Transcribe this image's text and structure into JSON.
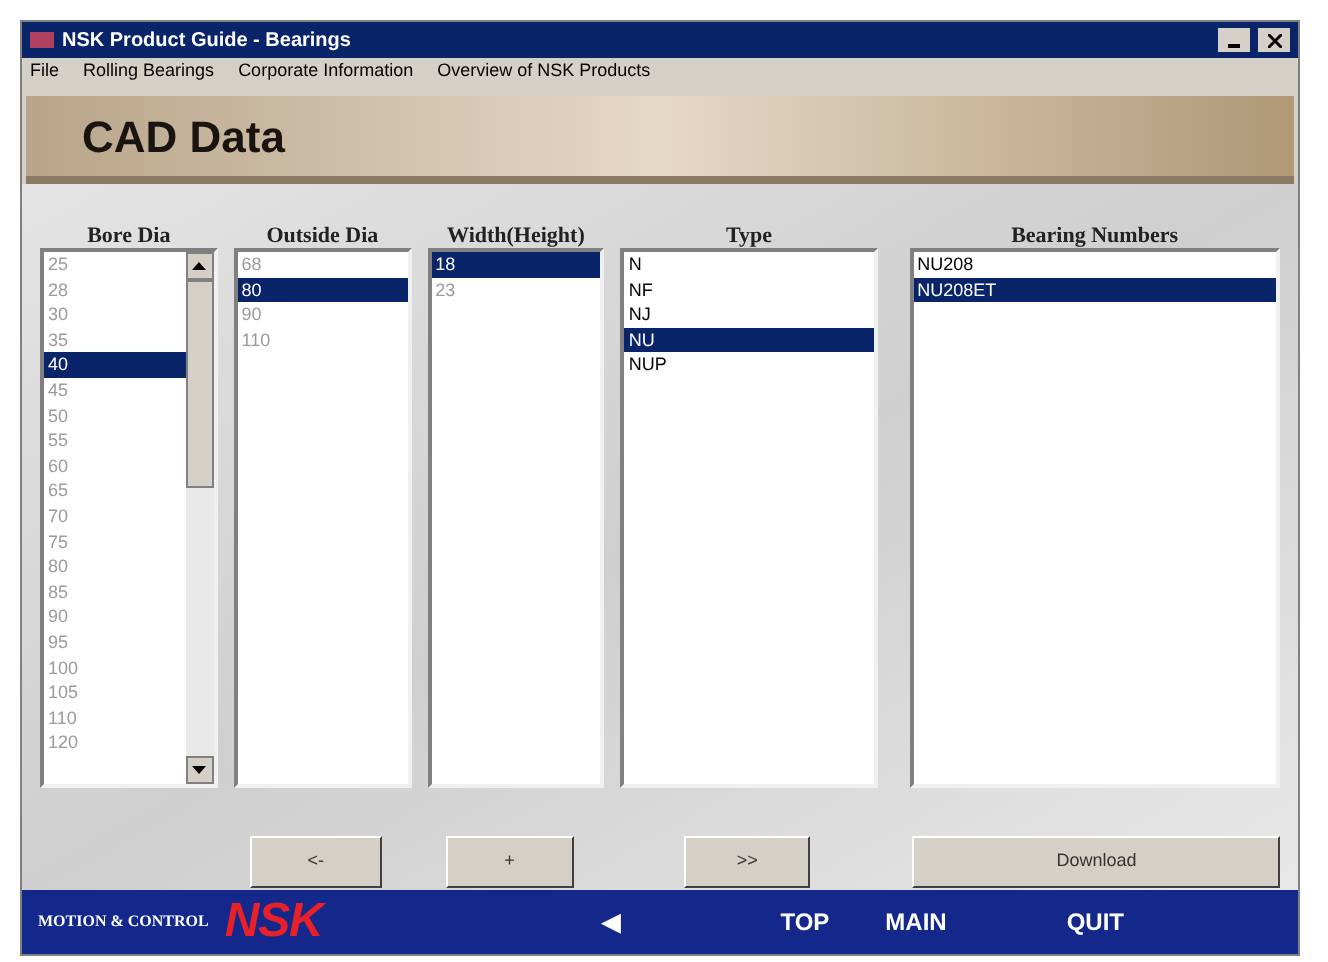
{
  "window": {
    "title": "NSK Product Guide - Bearings"
  },
  "menu": [
    "File",
    "Rolling Bearings",
    "Corporate Information",
    "Overview of NSK Products"
  ],
  "banner": {
    "title": "CAD Data"
  },
  "columns": [
    {
      "header": "Bore Dia",
      "dimmed": true,
      "scrollbar": true,
      "items": [
        {
          "text": "25",
          "selected": false
        },
        {
          "text": "28",
          "selected": false
        },
        {
          "text": "30",
          "selected": false
        },
        {
          "text": "35",
          "selected": false
        },
        {
          "text": "40",
          "selected": true
        },
        {
          "text": "45",
          "selected": false
        },
        {
          "text": "50",
          "selected": false
        },
        {
          "text": "55",
          "selected": false
        },
        {
          "text": "60",
          "selected": false
        },
        {
          "text": "65",
          "selected": false
        },
        {
          "text": "70",
          "selected": false
        },
        {
          "text": "75",
          "selected": false
        },
        {
          "text": "80",
          "selected": false
        },
        {
          "text": "85",
          "selected": false
        },
        {
          "text": "90",
          "selected": false
        },
        {
          "text": "95",
          "selected": false
        },
        {
          "text": "100",
          "selected": false
        },
        {
          "text": "105",
          "selected": false
        },
        {
          "text": "110",
          "selected": false
        },
        {
          "text": "120",
          "selected": false
        }
      ]
    },
    {
      "header": "Outside Dia",
      "dimmed": true,
      "scrollbar": false,
      "items": [
        {
          "text": "68",
          "selected": false
        },
        {
          "text": "80",
          "selected": true
        },
        {
          "text": "90",
          "selected": false
        },
        {
          "text": "110",
          "selected": false
        }
      ]
    },
    {
      "header": "Width(Height)",
      "dimmed": true,
      "scrollbar": false,
      "items": [
        {
          "text": "18",
          "selected": true
        },
        {
          "text": "23",
          "selected": false
        }
      ]
    },
    {
      "header": "Type",
      "dimmed": false,
      "scrollbar": false,
      "items": [
        {
          "text": "N",
          "selected": false
        },
        {
          "text": "NF",
          "selected": false
        },
        {
          "text": "NJ",
          "selected": false
        },
        {
          "text": "NU",
          "selected": true
        },
        {
          "text": "NUP",
          "selected": false
        }
      ]
    },
    {
      "header": "Bearing Numbers",
      "dimmed": false,
      "scrollbar": false,
      "items": [
        {
          "text": "NU208",
          "selected": false
        },
        {
          "text": "NU208ET",
          "selected": true
        }
      ]
    }
  ],
  "buttons": [
    "<-",
    "+",
    ">>",
    "Download"
  ],
  "footer": {
    "tagline": "MOTION & CONTROL",
    "logo": "NSK",
    "nav": [
      "◀",
      "TOP",
      "MAIN",
      "QUIT"
    ]
  }
}
